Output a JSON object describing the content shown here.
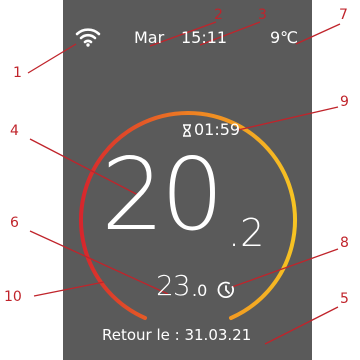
{
  "thermostat": {
    "day": "Mar",
    "time": "15:11",
    "outdoor_temp": "9℃",
    "timer": "01:59",
    "temp_int": "20",
    "temp_dec": ".2",
    "setpoint_int": "23",
    "setpoint_dec": ".0",
    "return_date": "Retour le : 31.03.21"
  },
  "callouts": [
    "1",
    "2",
    "3",
    "4",
    "5",
    "6",
    "7",
    "8",
    "9",
    "10"
  ],
  "colors": {
    "callout": "#c0242b",
    "screen_bg": "#5a5a5a",
    "ring_start": "#d7262d",
    "ring_mid": "#ee7e22",
    "ring_end": "#f7c423",
    "text": "#ffffff"
  },
  "icons": [
    "wifi-icon",
    "hourglass-icon",
    "clock-icon"
  ]
}
